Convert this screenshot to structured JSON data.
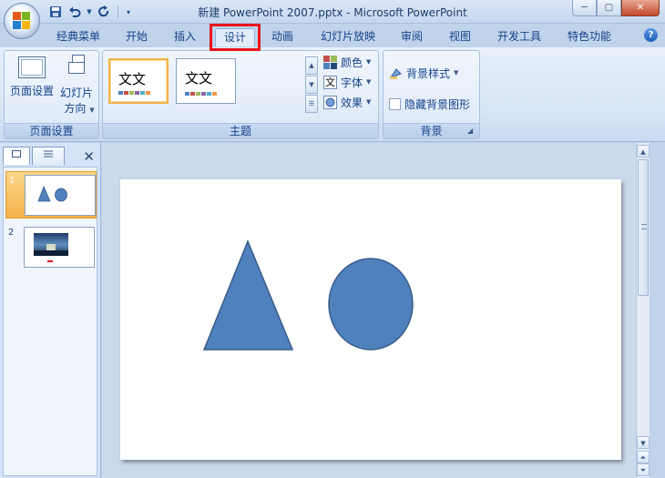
{
  "window": {
    "title": "新建 PowerPoint 2007.pptx - Microsoft PowerPoint",
    "controls": [
      "─",
      "▢",
      "✕"
    ]
  },
  "qat": {
    "save_icon": "save-icon",
    "undo_icon": "undo-icon",
    "redo_icon": "redo-icon",
    "customize_icon": "qat-customize-icon"
  },
  "tabs": [
    {
      "label": "经典菜单"
    },
    {
      "label": "开始"
    },
    {
      "label": "插入"
    },
    {
      "label": "设计"
    },
    {
      "label": "动画"
    },
    {
      "label": "幻灯片放映"
    },
    {
      "label": "审阅"
    },
    {
      "label": "视图"
    },
    {
      "label": "开发工具"
    },
    {
      "label": "特色功能"
    }
  ],
  "active_tab": "设计",
  "help_label": "?",
  "ribbon": {
    "page_setup": {
      "label": "页面设置",
      "page_setup_btn": "页面设置",
      "orientation_btn_line1": "幻灯片",
      "orientation_btn_line2": "方向"
    },
    "themes": {
      "label": "主题",
      "thumb_text_1": "文文",
      "thumb_text_2": "文文",
      "colors_btn": "颜色",
      "fonts_btn": "字体",
      "effects_btn": "效果"
    },
    "background": {
      "label": "背景",
      "styles_btn": "背景样式",
      "hide_graphics": "隐藏背景图形",
      "hide_graphics_checked": false
    }
  },
  "slides_pane": {
    "slides": [
      {
        "number": "1",
        "selected": true
      },
      {
        "number": "2",
        "selected": false
      }
    ]
  },
  "colors": {
    "shape_fill": "#4f81bd",
    "shape_stroke": "#385d8a",
    "selection": "#f5b24b",
    "highlight_box": "#e8141b"
  }
}
